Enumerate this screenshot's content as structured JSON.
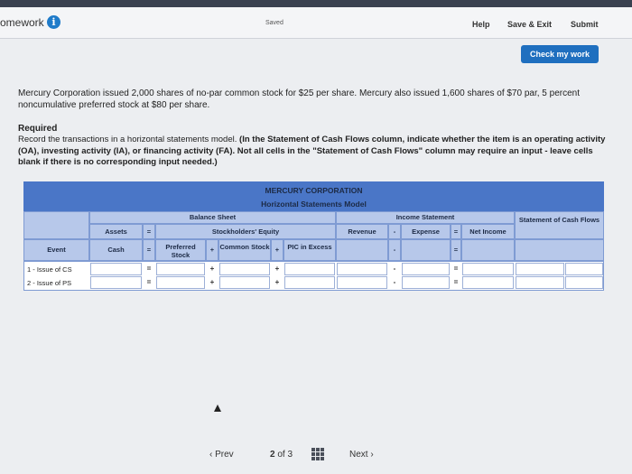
{
  "header": {
    "title": "omework",
    "info_icon": "i",
    "saved": "Saved",
    "help": "Help",
    "save_exit": "Save & Exit",
    "submit": "Submit"
  },
  "check_work": "Check my work",
  "question": "Mercury Corporation issued 2,000 shares of no-par common stock for $25 per share. Mercury also issued 1,600 shares of $70 par, 5 percent noncumulative preferred stock at $80 per share.",
  "required": {
    "heading": "Required",
    "intro": "Record the transactions in a horizontal statements model.",
    "bold_note": "(In the Statement of Cash Flows column, indicate whether the item is an operating activity (OA), investing activity (IA), or financing activity (FA). Not all cells in the \"Statement of Cash Flows\" column may require an input - leave cells blank if there is no corresponding input needed.)"
  },
  "model": {
    "company": "MERCURY CORPORATION",
    "subtitle": "Horizontal Statements Model",
    "balance_sheet": "Balance Sheet",
    "assets": "Assets",
    "equity": "Stockholders' Equity",
    "income_statement": "Income Statement",
    "cash_flows": "Statement of Cash Flows",
    "event": "Event",
    "cash": "Cash",
    "preferred_stock": "Preferred Stock",
    "common_stock": "Common Stock",
    "pic_excess": "PIC in Excess",
    "revenue": "Revenue",
    "expense": "Expense",
    "net_income": "Net Income",
    "ops": {
      "eq": "=",
      "plus": "+",
      "minus": "-"
    },
    "rows": [
      {
        "event": "1 - Issue of CS",
        "cash": "",
        "preferred": "",
        "common": "",
        "pic": "",
        "revenue": "",
        "expense": "",
        "net_income": "",
        "cash_flow_amount": "",
        "cash_flow_type": ""
      },
      {
        "event": "2 - Issue of PS",
        "cash": "",
        "preferred": "",
        "common": "",
        "pic": "",
        "revenue": "",
        "expense": "",
        "net_income": "",
        "cash_flow_amount": "",
        "cash_flow_type": ""
      }
    ]
  },
  "footer": {
    "prev": "‹ Prev",
    "page_current": "2",
    "page_of": "of",
    "page_total": "3",
    "next": "Next ›"
  }
}
